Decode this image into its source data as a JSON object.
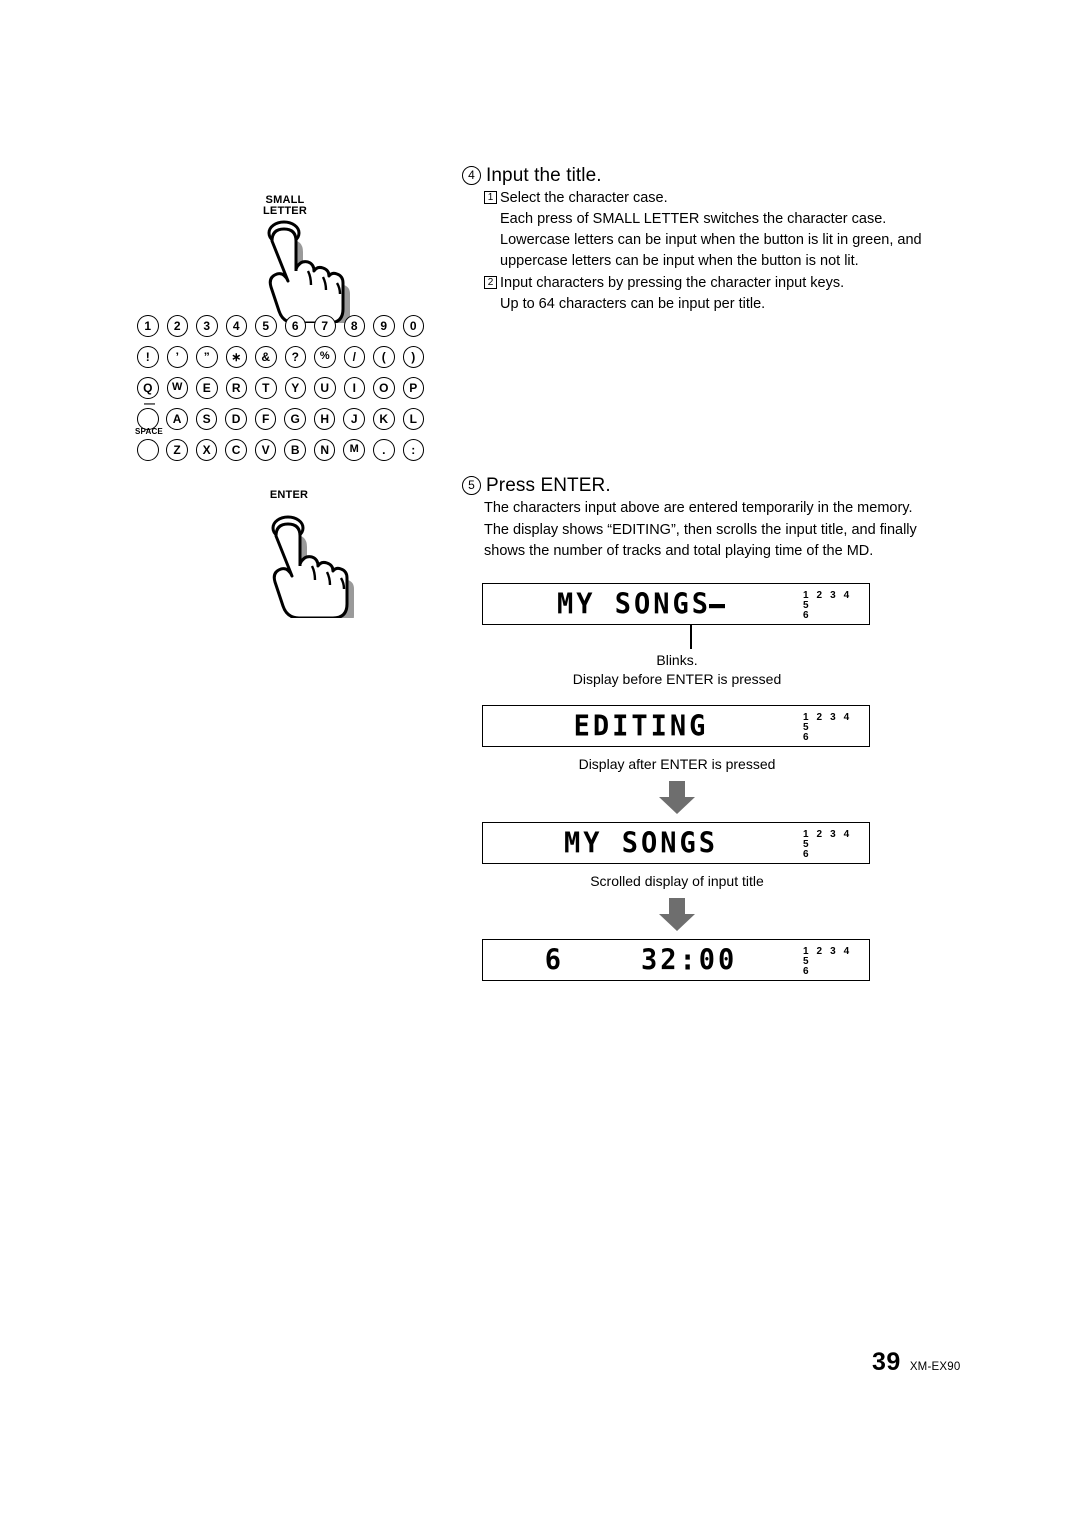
{
  "page": {
    "number": "39",
    "model": "XM-EX90"
  },
  "steps": [
    {
      "marker": "4",
      "title": "Input the title.",
      "substeps": [
        {
          "marker": "1",
          "text": "Select the character case.",
          "paragraphs": [
            "Each press of SMALL LETTER switches the character case.",
            "Lowercase letters can be input when the button is lit in green, and uppercase letters can be input when the button is not lit."
          ]
        },
        {
          "marker": "2",
          "text": "Input characters by pressing the character input keys.",
          "paragraphs": [
            "Up to 64 characters can be input per title."
          ]
        }
      ]
    },
    {
      "marker": "5",
      "title": "Press ENTER.",
      "body": "The characters input above are entered temporarily in the memory. The display shows “EDITING”, then scrolls the input title, and finally shows the number of tracks and total playing time of the MD."
    }
  ],
  "illustration": {
    "small_letter_button": {
      "caption_line1": "SMALL",
      "caption_line2": "LETTER"
    },
    "enter_button": {
      "caption": "ENTER"
    },
    "keypad_rows": [
      {
        "keys": [
          "1",
          "2",
          "3",
          "4",
          "5",
          "6",
          "7",
          "8",
          "9",
          "0"
        ]
      },
      {
        "keys": [
          "!",
          "’",
          "”",
          "∗",
          "&",
          "?",
          "%",
          "/",
          "(",
          ")"
        ]
      },
      {
        "keys": [
          "Q",
          "W",
          "E",
          "R",
          "T",
          "Y",
          "U",
          "I",
          "O",
          "P"
        ]
      },
      {
        "keys": [
          "",
          "A",
          "S",
          "D",
          "F",
          "G",
          "H",
          "J",
          "K",
          "L"
        ],
        "first_key_label": "—"
      },
      {
        "keys": [
          "",
          "Z",
          "X",
          "C",
          "V",
          "B",
          "N",
          "M",
          ".",
          ":"
        ],
        "first_key_label": "SPACE"
      }
    ]
  },
  "displays": [
    {
      "name": "before-enter",
      "text": "MY SONGS",
      "has_cursor": true,
      "track_row1": "1 2 3 4 5",
      "track_row2": "6",
      "annotations": [
        "Blinks.",
        "Display before ENTER is pressed"
      ]
    },
    {
      "name": "editing",
      "text": "EDITING",
      "has_cursor": false,
      "track_row1": "1 2 3 4 5",
      "track_row2": "6",
      "annotations": [
        "Display after ENTER is pressed"
      ]
    },
    {
      "name": "scrolled-title",
      "text": "MY SONGS",
      "has_cursor": false,
      "track_row1": "1 2 3 4 5",
      "track_row2": "6",
      "annotations": [
        "Scrolled display of input title"
      ]
    },
    {
      "name": "track-time",
      "text": "6    32:00",
      "has_cursor": false,
      "track_row1": "1 2 3 4 5",
      "track_row2": "6",
      "annotations": []
    }
  ],
  "colors": {
    "ink": "#000000",
    "paper": "#ffffff",
    "arrow_gray": "#6e6e6e",
    "shadow_gray": "#8a8a8a"
  }
}
